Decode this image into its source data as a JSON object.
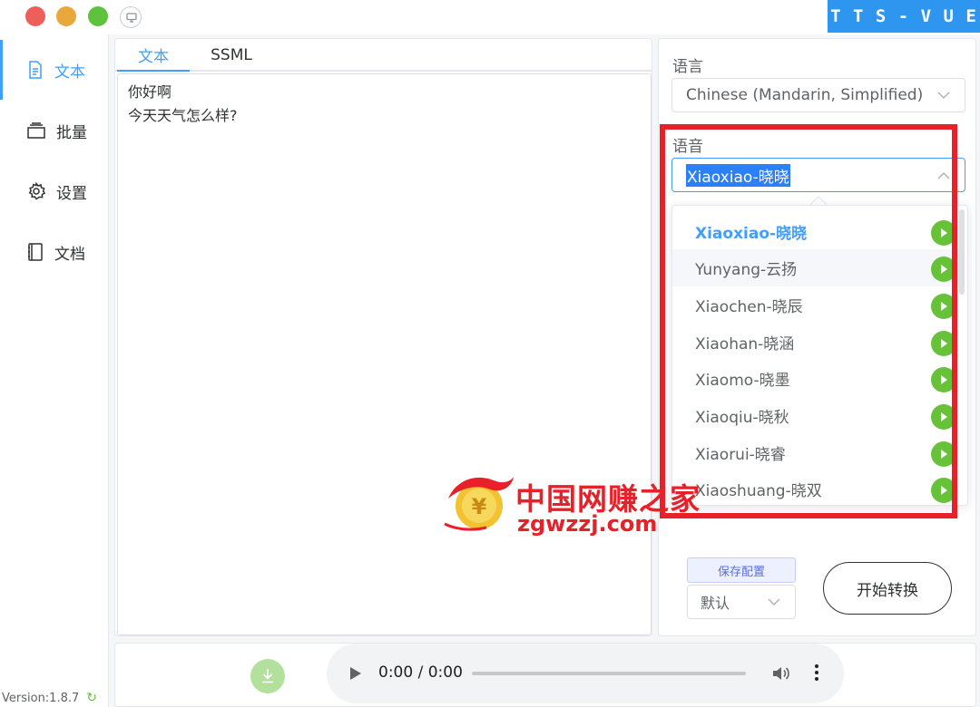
{
  "brand": "T T S - V U E",
  "sidebar": {
    "items": [
      {
        "label": "文本",
        "icon": "document-icon",
        "active": true
      },
      {
        "label": "批量",
        "icon": "batch-icon",
        "active": false
      },
      {
        "label": "设置",
        "icon": "gear-icon",
        "active": false
      },
      {
        "label": "文档",
        "icon": "notebook-icon",
        "active": false
      }
    ],
    "version": "Version:1.8.7"
  },
  "editor": {
    "tabs": [
      {
        "label": "文本"
      },
      {
        "label": "SSML"
      }
    ],
    "text": "你好啊\n今天天气怎么样?"
  },
  "options": {
    "language_label": "语言",
    "language_value": "Chinese (Mandarin, Simplified)",
    "voice_label": "语音",
    "voice_value": "Xiaoxiao-晓晓",
    "voices": [
      {
        "label": "Xiaoxiao-晓晓"
      },
      {
        "label": "Yunyang-云扬"
      },
      {
        "label": "Xiaochen-晓辰"
      },
      {
        "label": "Xiaohan-晓涵"
      },
      {
        "label": "Xiaomo-晓墨"
      },
      {
        "label": "Xiaoqiu-晓秋"
      },
      {
        "label": "Xiaorui-晓睿"
      },
      {
        "label": "Xiaoshuang-晓双"
      }
    ],
    "save_label": "保存配置",
    "preset_value": "默认",
    "start_label": "开始转换"
  },
  "player": {
    "time": "0:00 / 0:00",
    "progress": 0
  },
  "watermark": {
    "cn": "中国网赚之家",
    "en": "zgwzzj.com"
  },
  "colors": {
    "accent": "#409eff",
    "play": "#67c23a",
    "highlight": "#e8202a",
    "brand_bg": "#2f96ef"
  }
}
